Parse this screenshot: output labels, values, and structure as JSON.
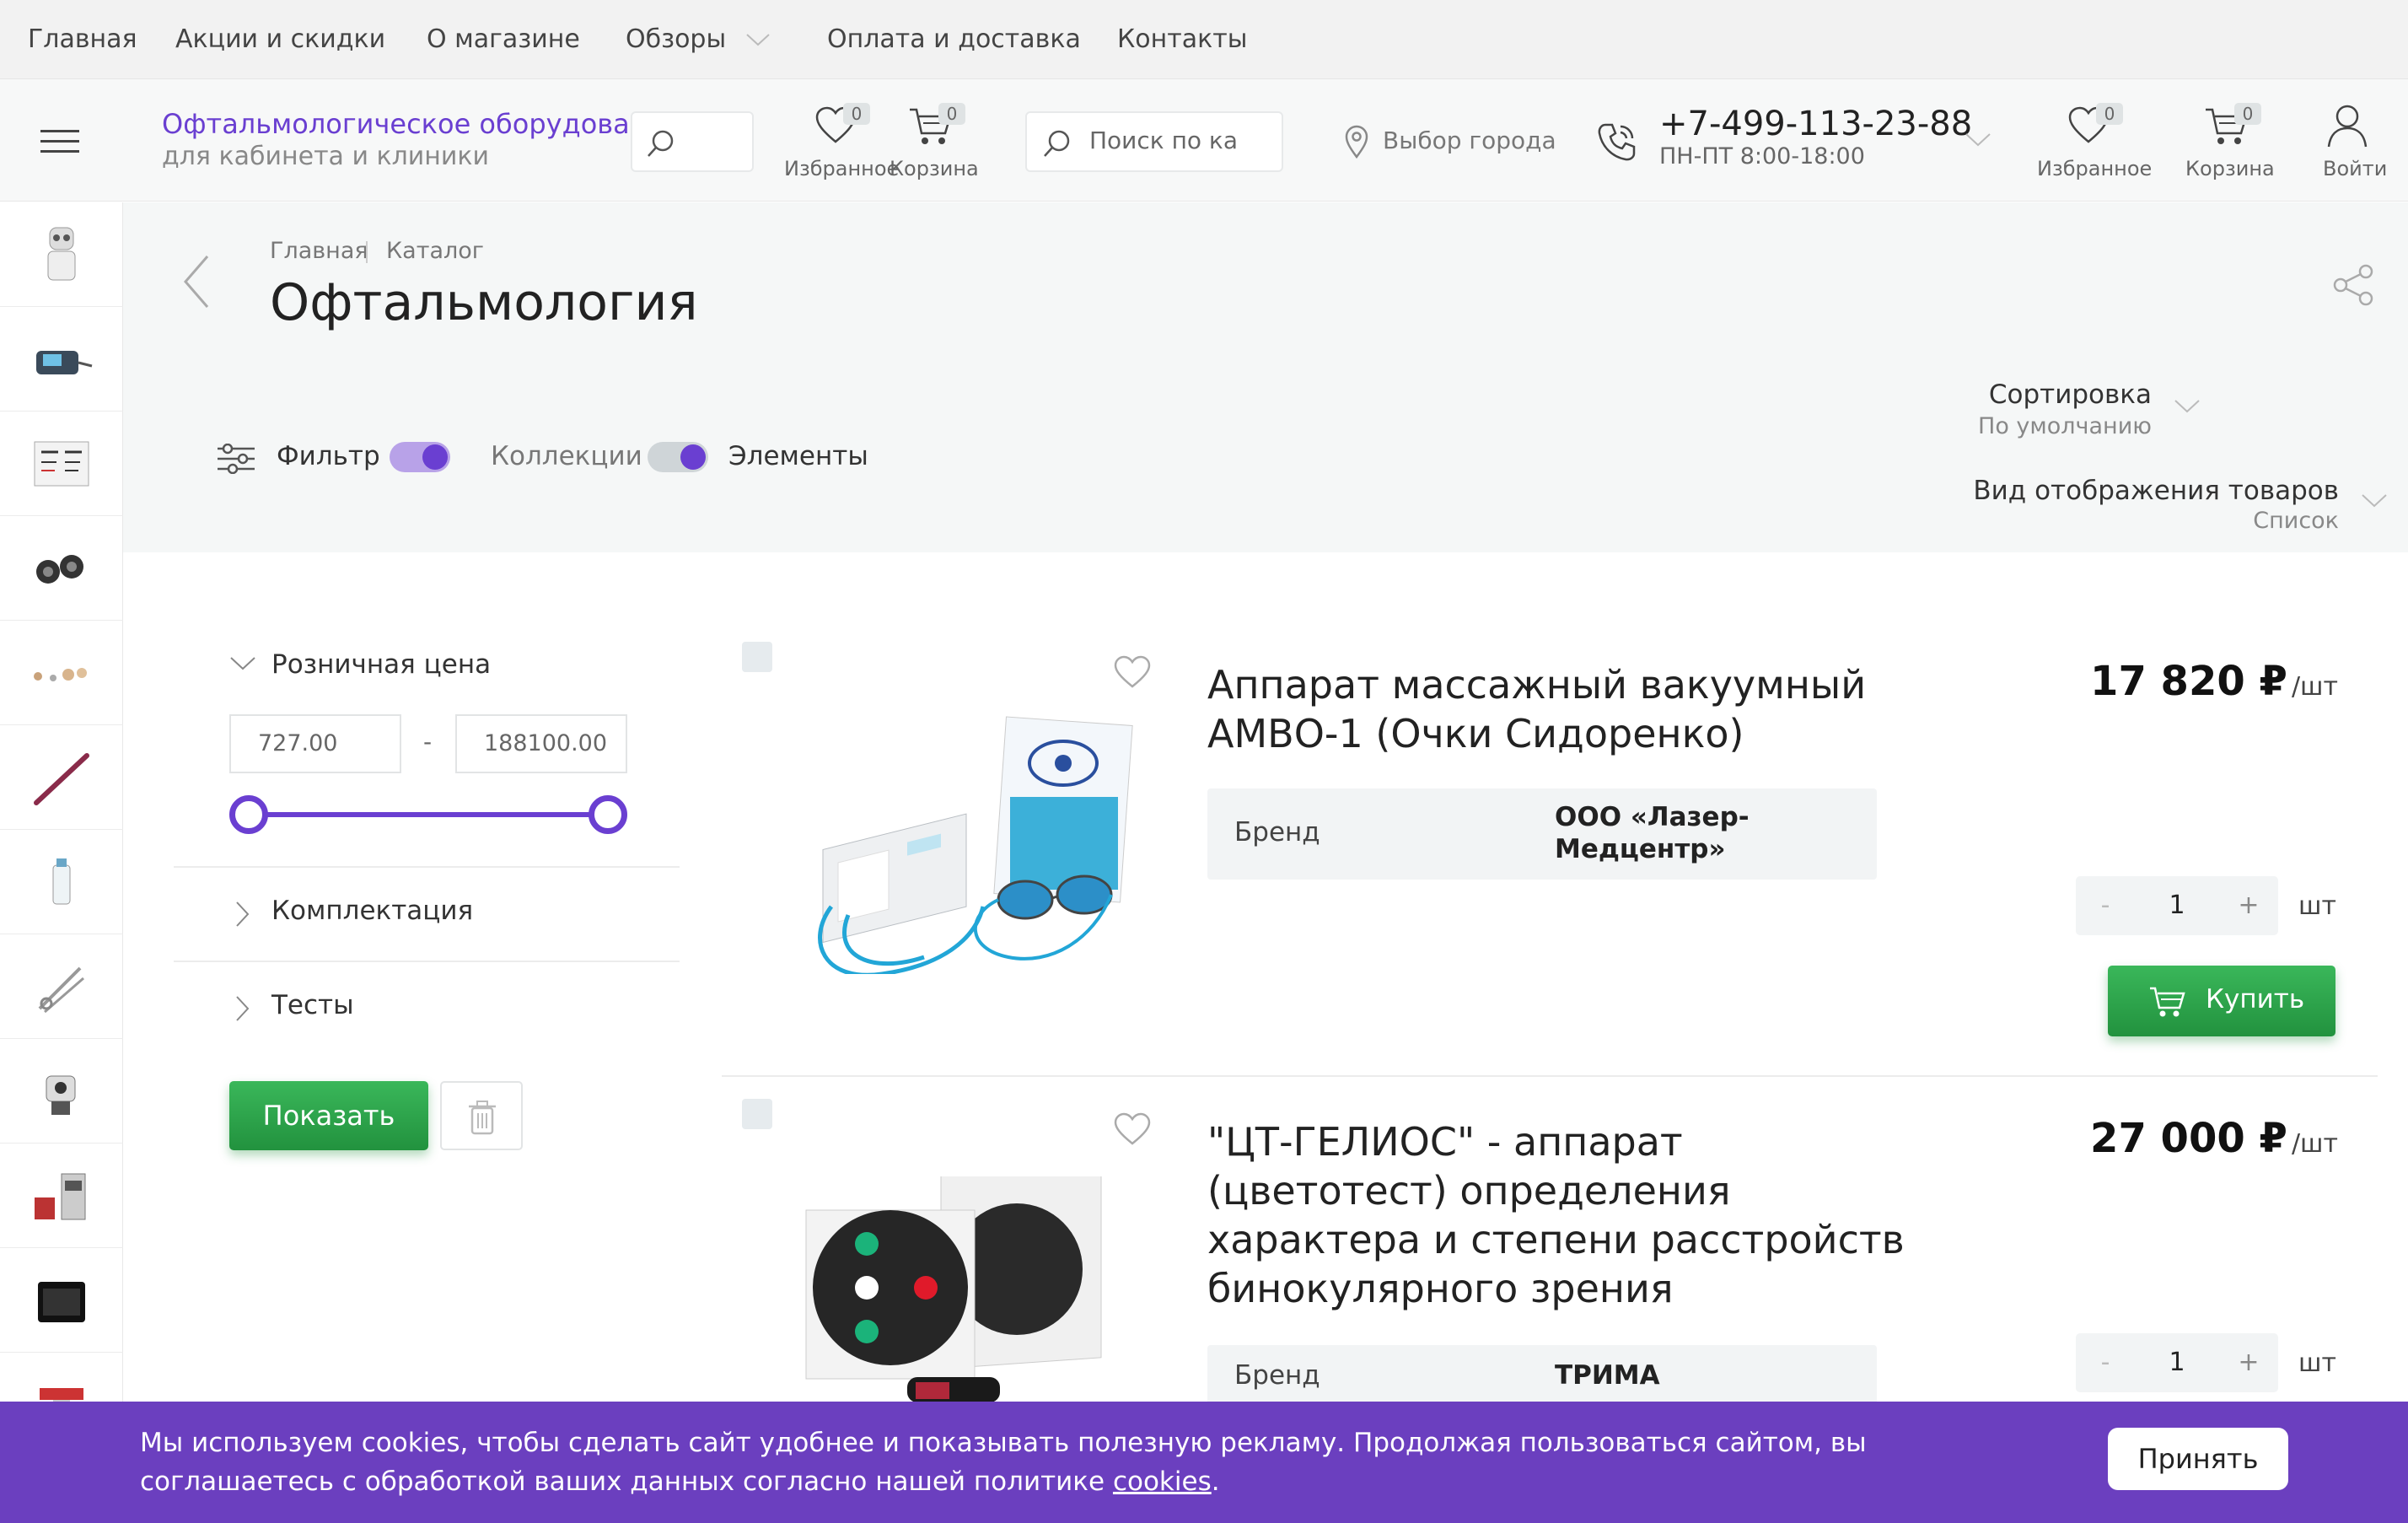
{
  "topnav": {
    "items": [
      "Главная",
      "Акции и скидки",
      "О магазине",
      "Обзоры",
      "Оплата и доставка",
      "Контакты"
    ]
  },
  "header": {
    "company_line1": "Офтальмологическое оборудование",
    "company_line2": "для кабинета и клиники",
    "favorites_label": "Избранное",
    "cart_label": "Корзина",
    "favorites_count": "0",
    "cart_count": "0",
    "search_placeholder": "Поиск по ка",
    "city": "Выбор города",
    "phone": "+7-499-113-23-88",
    "hours": "ПН-ПТ 8:00-18:00",
    "login_label": "Войти",
    "accent": "#6a3fd1"
  },
  "breadcrumb": [
    "Главная",
    "Каталог"
  ],
  "page_title": "Офтальмология",
  "toolbar": {
    "filter_label": "Фильтр",
    "collections_label": "Коллекции",
    "elements_label": "Элементы",
    "sort_label": "Сортировка",
    "sort_value": "По умолчанию",
    "view_label": "Вид отображения товаров",
    "view_value": "Список"
  },
  "filters": {
    "price_title": "Розничная цена",
    "price_min": "727.00",
    "price_dash": "-",
    "price_max": "188100.00",
    "group1": "Комплектация",
    "group2": "Тесты",
    "show_button": "Показать"
  },
  "products": [
    {
      "title_line1": "Аппарат массажный вакуумный",
      "title_line2": "АМВО-1 (Очки Сидоренко)",
      "brand_label": "Бренд",
      "brand_line1": "ООО «Лазер-",
      "brand_line2": "Медцентр»",
      "price": "17 820 ₽",
      "unit": "/шт",
      "qty": "1",
      "qty_unit": "шт",
      "buy_label": "Купить"
    },
    {
      "title_line1": "\"ЦТ-ГЕЛИОС\" - аппарат",
      "title_line2": "(цветотест) определения",
      "title_line3": "характера и степени расстройств",
      "title_line4": "бинокулярного зрения",
      "brand_label": "Бренд",
      "brand_line1": "ТРИМА",
      "price": "27 000 ₽",
      "unit": "/шт",
      "qty": "1",
      "qty_unit": "шт"
    }
  ],
  "qty_minus": "-",
  "qty_plus": "+",
  "cookie": {
    "text_line1": "Мы используем cookies, чтобы сделать сайт удобнее и показывать полезную рекламу. Продолжая пользоваться сайтом, вы",
    "text_line2": "соглашаетесь с обработкой ваших данных согласно нашей политике ",
    "link": "cookies",
    "dot": ".",
    "accept": "Принять"
  }
}
